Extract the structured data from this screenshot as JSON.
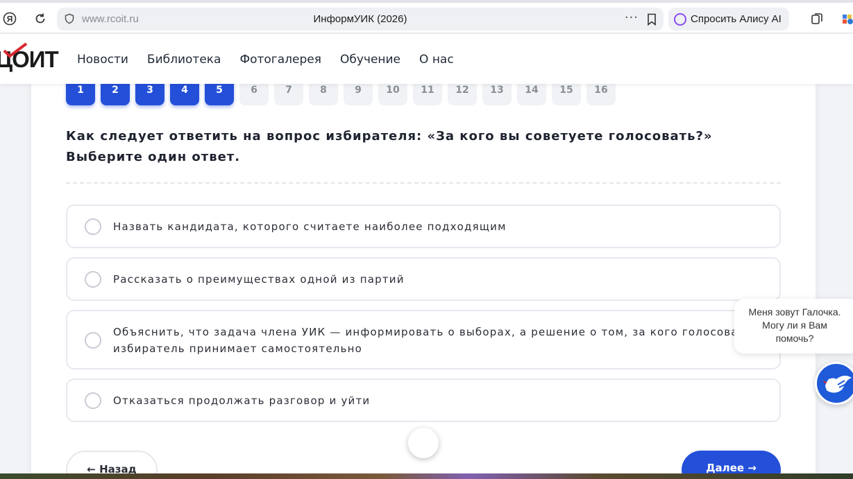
{
  "browser": {
    "url": "www.rcoit.ru",
    "page_title": "ИнформУИК (2026)",
    "alice_label": "Спросить Алису AI",
    "menu_dots": "···"
  },
  "site": {
    "logo_text": "ЦОИТ",
    "nav": [
      "Новости",
      "Библиотека",
      "Фотогалерея",
      "Обучение",
      "О нас"
    ]
  },
  "quiz": {
    "question_numbers": [
      "1",
      "2",
      "3",
      "4",
      "5",
      "6",
      "7",
      "8",
      "9",
      "10",
      "11",
      "12",
      "13",
      "14",
      "15",
      "16"
    ],
    "answered_count": 5,
    "question": "Как следует ответить на вопрос избирателя: «За кого вы советуете голосовать?» Выберите один ответ.",
    "answers": [
      "Назвать кандидата, которого считаете наиболее подходящим",
      "Рассказать о преимуществах одной из партий",
      "Объяснить, что задача члена УИК — информировать о выборах, а решение о том, за кого голосовать, избиратель принимает самостоятельно",
      "Отказаться продолжать разговор и уйти"
    ],
    "back_label": "← Назад",
    "next_label": "Далее →"
  },
  "chat": {
    "message": "Меня зовут Галочка. Могу ли я Вам помочь?"
  },
  "colors": {
    "accent": "#2450d9",
    "alice": "#8a4cf0"
  }
}
